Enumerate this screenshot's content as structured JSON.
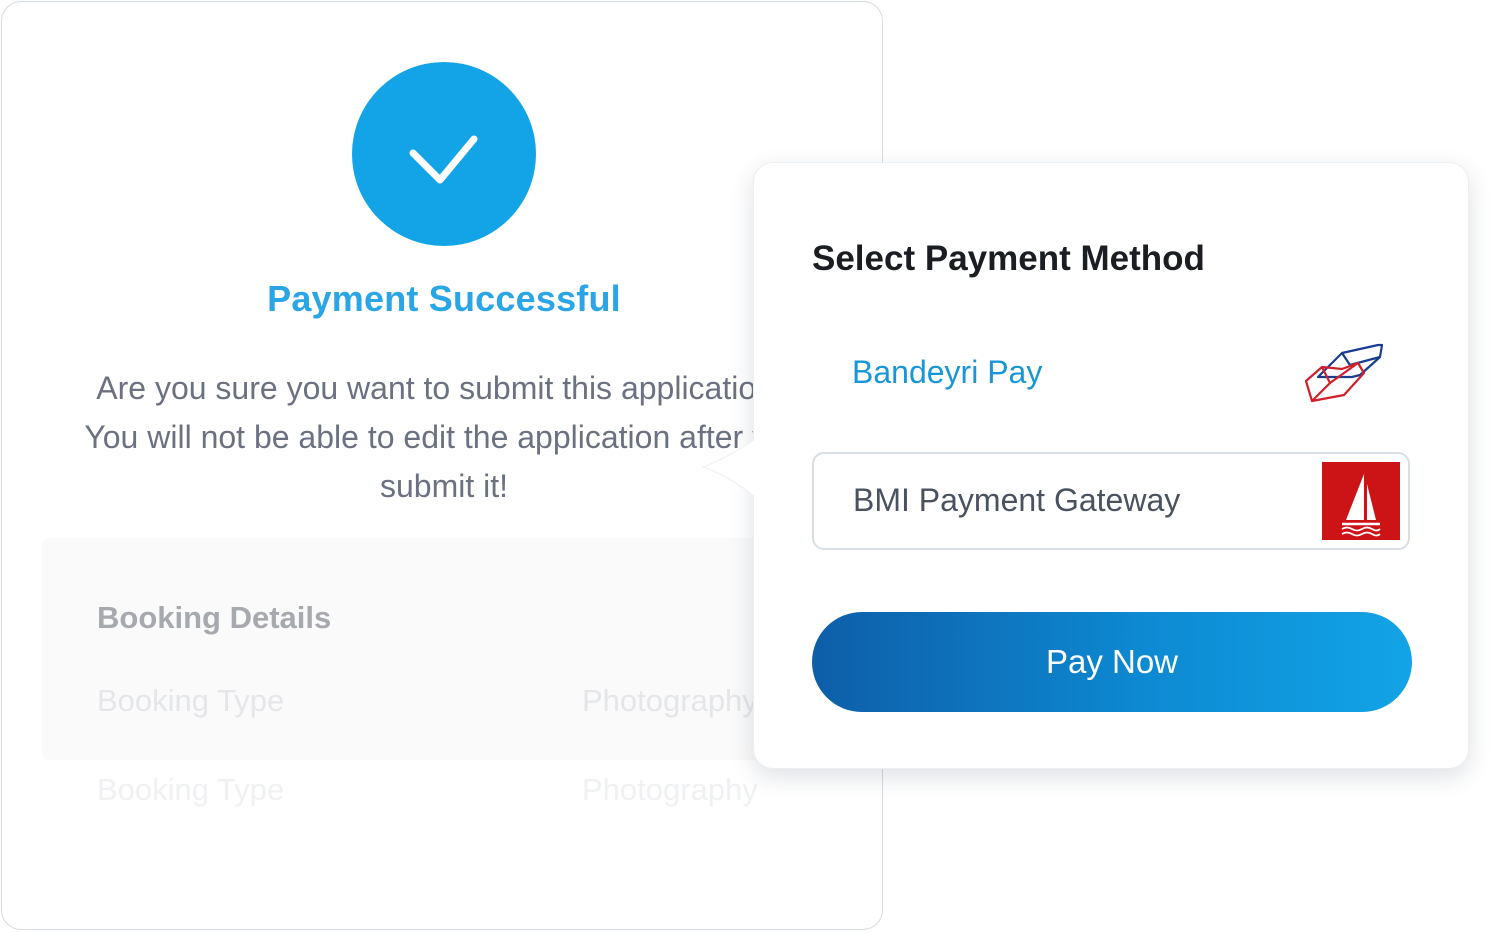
{
  "success": {
    "title": "Payment Successful",
    "line1": "Are you sure you want to submit this application?",
    "line2": "You will not be able to edit the application after you",
    "line3": "submit it!",
    "icon": "check-icon"
  },
  "booking": {
    "heading": "Booking Details",
    "rows": [
      {
        "label": "Booking Type",
        "value": "Photography"
      },
      {
        "label": "Booking Type",
        "value": "Photography"
      }
    ]
  },
  "payment": {
    "title": "Select Payment Method",
    "methods": [
      {
        "label": "Bandeyri Pay",
        "icon": "bandeyri-logo-icon",
        "selected": false
      },
      {
        "label": "BMI Payment Gateway",
        "icon": "bmi-logo-icon",
        "selected": true
      }
    ],
    "pay_label": "Pay Now"
  },
  "colors": {
    "accent": "#12a4e6",
    "success_title": "#2aa5e6",
    "button_start": "#0e5ea8",
    "button_end": "#12a4e6",
    "bmi_red": "#cc1316"
  }
}
